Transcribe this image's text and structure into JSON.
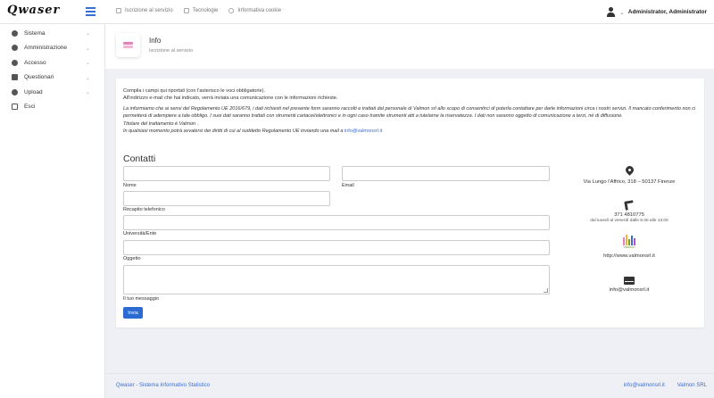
{
  "header": {
    "logo": "Qwaser",
    "nav": [
      {
        "label": "Iscrizione al servizio",
        "icon": "form-icon"
      },
      {
        "label": "Tecnologie",
        "icon": "document-icon"
      },
      {
        "label": "Informativa cookie",
        "icon": "cookie-icon"
      }
    ],
    "user_name": "Administrator, Administrator",
    "user_chevron": "⌄"
  },
  "sidebar": {
    "items": [
      {
        "label": "Sistema",
        "icon": "system-icon",
        "has_chevron": true
      },
      {
        "label": "Amministrazione",
        "icon": "admin-icon",
        "has_chevron": true
      },
      {
        "label": "Accesso",
        "icon": "access-icon",
        "has_chevron": true
      },
      {
        "label": "Questionari",
        "icon": "questionnaire-icon",
        "has_chevron": true
      },
      {
        "label": "Upload",
        "icon": "upload-icon",
        "has_chevron": true
      },
      {
        "label": "Esci",
        "icon": "logout-icon",
        "has_chevron": false
      }
    ],
    "chevron": "⌄"
  },
  "page": {
    "title": "Info",
    "subtitle": "Iscrizione al servizio"
  },
  "intro": {
    "line1": "Compila i campi qui riportati (con l'asterisco le voci obbligatorie).",
    "line2": "All'indirizzo e-mail che hai indicato, verrà inviata una comunicazione con le informazioni richieste."
  },
  "privacy": {
    "text": "La informiamo che ai sensi del Regolamento UE 2016/679, i dati richiesti nel presente form saranno raccolti e trattati dal personale di Valmon srl allo scopo di consentirci di poterla contattare per darle informazioni circa i nostri servizi. Il mancato conferimento non ci permetterà di adempiere a tale obbligo. I suoi dati saranno trattati con strumenti cartacei/elettronici e in ogni caso tramite strumenti atti a tutelarne la riservatezza. I dati non saranno oggetto di comunicazione a terzi, né di diffusione.",
    "owner": "Titolare del trattamento è Valmon .",
    "rights": "In qualsiasi momento potrà avvalersi dei diritti di cui al suddetto Regolamento UE inviando una mail a",
    "email": "info@valmonsrl.it"
  },
  "form": {
    "title": "Contatti",
    "labels": {
      "nome": "Nome",
      "email": "Email",
      "telefono": "Recapito telefonico",
      "universita": "Università/Ente",
      "oggetto": "Oggetto",
      "messaggio": "Il tuo messaggio"
    },
    "values": {
      "nome": "",
      "email": "",
      "telefono": "",
      "universita": "",
      "oggetto": "",
      "messaggio": ""
    },
    "submit": "Invia"
  },
  "contact": {
    "address": "Via Lungo l'Affrico, 318 – 50137 Firenze",
    "phone": "371 4810775",
    "hours": "dal lunedì al venerdì dalle 8.30 alle 13.00",
    "logo_text": "Valmon",
    "website": "http://www.valmonsrl.it",
    "email": "info@valmonsrl.it"
  },
  "footer": {
    "left": "Qwaser - Sistema Informativo Statistico",
    "email": "info@valmonsrl.it",
    "company": "Valmon SRL"
  },
  "colors": {
    "accent": "#3a6fd1",
    "button": "#2c6bd1",
    "background": "#eef0f5"
  }
}
